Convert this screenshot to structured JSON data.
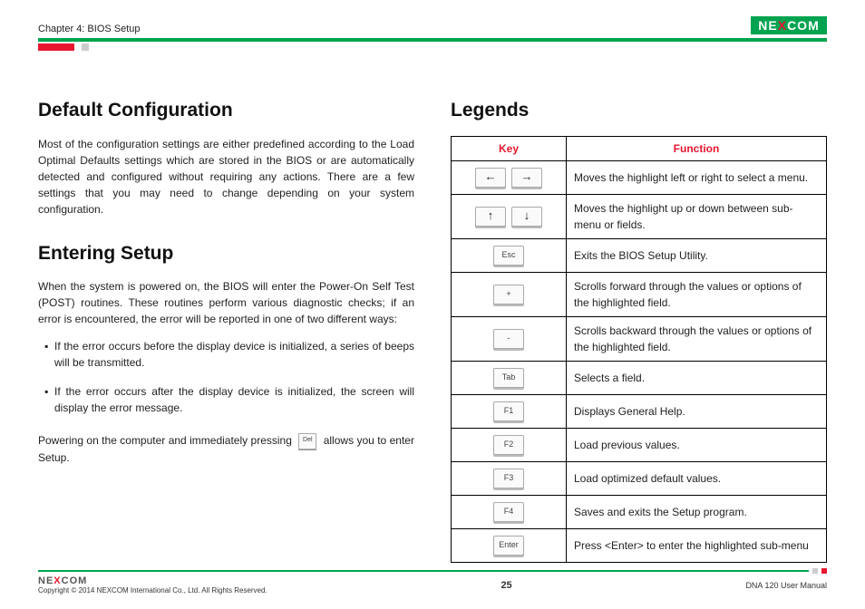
{
  "header": {
    "chapter": "Chapter 4: BIOS Setup",
    "logo_text_1": "NE",
    "logo_text_x": "X",
    "logo_text_2": "COM"
  },
  "left": {
    "h1": "Default Configuration",
    "p1": "Most of the configuration settings are either predefined according to the Load Optimal Defaults settings which are stored in the BIOS or are automatically detected and configured without requiring any actions. There are a few settings that you may need to change depending on your system configuration.",
    "h2": "Entering Setup",
    "p2": "When the system is powered on, the BIOS will enter the Power-On Self Test (POST) routines. These routines perform various diagnostic checks; if an error is encountered, the error will be reported in one of two different ways:",
    "b1": "If the error occurs before the display device is initialized, a series of beeps will be transmitted.",
    "b2": "If the error occurs after the display device is initialized, the screen will display the error message.",
    "p3a": "Powering on the computer and immediately pressing",
    "p3key": "Del",
    "p3b": "allows you to enter Setup."
  },
  "right": {
    "h1": "Legends",
    "th_key": "Key",
    "th_func": "Function",
    "rows": [
      {
        "keys": [
          "←",
          "→"
        ],
        "func": "Moves the highlight left or right to select a menu."
      },
      {
        "keys": [
          "↑",
          "↓"
        ],
        "func": "Moves the highlight up or down between sub-menu or fields."
      },
      {
        "keys": [
          "Esc"
        ],
        "func": "Exits the BIOS Setup Utility."
      },
      {
        "keys": [
          "+"
        ],
        "func": "Scrolls forward through the values or options of the highlighted field."
      },
      {
        "keys": [
          "-"
        ],
        "func": "Scrolls backward through the values or options of the highlighted field."
      },
      {
        "keys": [
          "Tab"
        ],
        "func": "Selects a field."
      },
      {
        "keys": [
          "F1"
        ],
        "func": "Displays General Help."
      },
      {
        "keys": [
          "F2"
        ],
        "func": "Load previous values."
      },
      {
        "keys": [
          "F3"
        ],
        "func": "Load optimized default values."
      },
      {
        "keys": [
          "F4"
        ],
        "func": "Saves and exits the Setup program."
      },
      {
        "keys": [
          "Enter"
        ],
        "func": "Press <Enter> to enter the highlighted sub-menu"
      }
    ]
  },
  "footer": {
    "brand_1": "NE",
    "brand_x": "X",
    "brand_2": "COM",
    "copyright": "Copyright © 2014 NEXCOM International Co., Ltd. All Rights Reserved.",
    "page": "25",
    "manual": "DNA 120 User Manual"
  }
}
